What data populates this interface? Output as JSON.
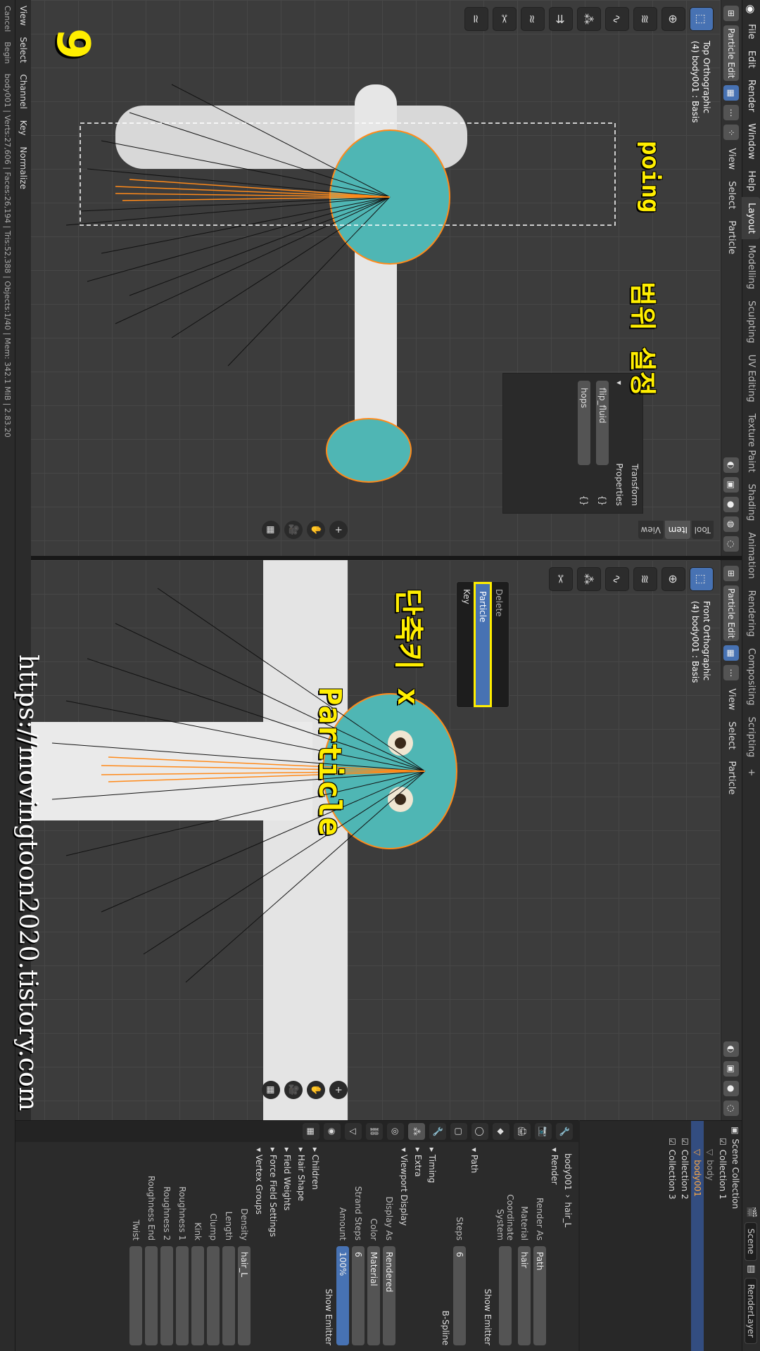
{
  "app": {
    "menus": [
      "File",
      "Edit",
      "Render",
      "Window",
      "Help"
    ],
    "workspaces": [
      "Layout",
      "Modelling",
      "Sculpting",
      "UV Editing",
      "Texture Paint",
      "Shading",
      "Animation",
      "Rendering",
      "Compositing",
      "Scripting"
    ],
    "active_workspace": "Layout",
    "add_workspace": "+",
    "scene_label": "Scene",
    "viewlayer_label": "RenderLayer"
  },
  "top_viewport": {
    "mode": "Particle Edit",
    "menus": [
      "View",
      "Select",
      "Particle"
    ],
    "view_name": "Top Orthographic",
    "object_info": "(4) body001 : Basis",
    "npanel_tabs": [
      "Tool",
      "Item",
      "View"
    ],
    "npanel": {
      "transform_label": "Transform",
      "properties_label": "Properties",
      "props": [
        {
          "name": "flip_fluid",
          "value": "{}"
        },
        {
          "name": "hops",
          "value": "{}"
        }
      ]
    }
  },
  "front_viewport": {
    "mode": "Particle Edit",
    "menus": [
      "View",
      "Select",
      "Particle"
    ],
    "view_name": "Front Orthographic",
    "object_info": "(4) body001 : Basis"
  },
  "delete_menu": {
    "title": "Delete",
    "items": [
      "Particle",
      "Key"
    ],
    "highlighted": "Particle"
  },
  "annotations": {
    "step_number": "9",
    "poing": "poing",
    "range": "범위 설정",
    "shortcut": "단축키 x",
    "particle": "Particle",
    "watermark": "https://movingtoon2020.tistory.com"
  },
  "timeline": {
    "menus": [
      "View",
      "Select",
      "Channel",
      "Key"
    ],
    "normalize": "Normalize",
    "cancel": "Cancel",
    "begin": "Begin"
  },
  "outliner": {
    "title": "Scene Collection",
    "items": [
      {
        "name": "Collection 1",
        "selected": false
      },
      {
        "name": "body",
        "selected": false
      },
      {
        "name": "body001",
        "selected": true
      },
      {
        "name": "Collection 2",
        "selected": false
      },
      {
        "name": "Collection 3",
        "selected": false
      }
    ]
  },
  "properties": {
    "object_name": "body001",
    "particle_system": "hair_L",
    "sections": {
      "render": "Render",
      "path": "Path",
      "timing": "Timing",
      "extra": "Extra",
      "viewport_display": "Viewport Display",
      "children": "Children",
      "hair_shape": "Hair Shape",
      "field_weights": "Field Weights",
      "force_field": "Force Field Settings",
      "vertex_groups": "Vertex Groups"
    },
    "render_rows": [
      {
        "label": "Render As",
        "value": "Path"
      },
      {
        "label": "Material",
        "value": "hair"
      },
      {
        "label": "Coordinate System",
        "value": ""
      },
      {
        "label": "",
        "value": "Show Emitter"
      }
    ],
    "path_rows": [
      {
        "label": "Steps",
        "value": "6"
      },
      {
        "label": "",
        "value": "B-Spline"
      }
    ],
    "display_rows": [
      {
        "label": "Display As",
        "value": "Rendered"
      },
      {
        "label": "Color",
        "value": "Material"
      },
      {
        "label": "Strand Steps",
        "value": "6"
      },
      {
        "label": "Amount",
        "value": "100%"
      },
      {
        "label": "",
        "value": "Show Emitter"
      }
    ],
    "vg_rows": [
      {
        "label": "Density",
        "value": "hair_L"
      },
      {
        "label": "Length",
        "value": ""
      },
      {
        "label": "Clump",
        "value": ""
      },
      {
        "label": "Kink",
        "value": ""
      },
      {
        "label": "Roughness 1",
        "value": ""
      },
      {
        "label": "Roughness 2",
        "value": ""
      },
      {
        "label": "Roughness End",
        "value": ""
      },
      {
        "label": "Twist",
        "value": ""
      }
    ]
  },
  "status": {
    "left": "body001 | Verts:27,606 | Faces:26,194 | Tris:52,388 | Objects:1/40 | Mem: 342.1 MiB | 2.83.20"
  },
  "colors": {
    "accent_blue": "#4772b3",
    "annotation_yellow": "#ffee00",
    "mesh_teal": "#4fb6b4",
    "selected_orange": "#ff8a1a"
  }
}
